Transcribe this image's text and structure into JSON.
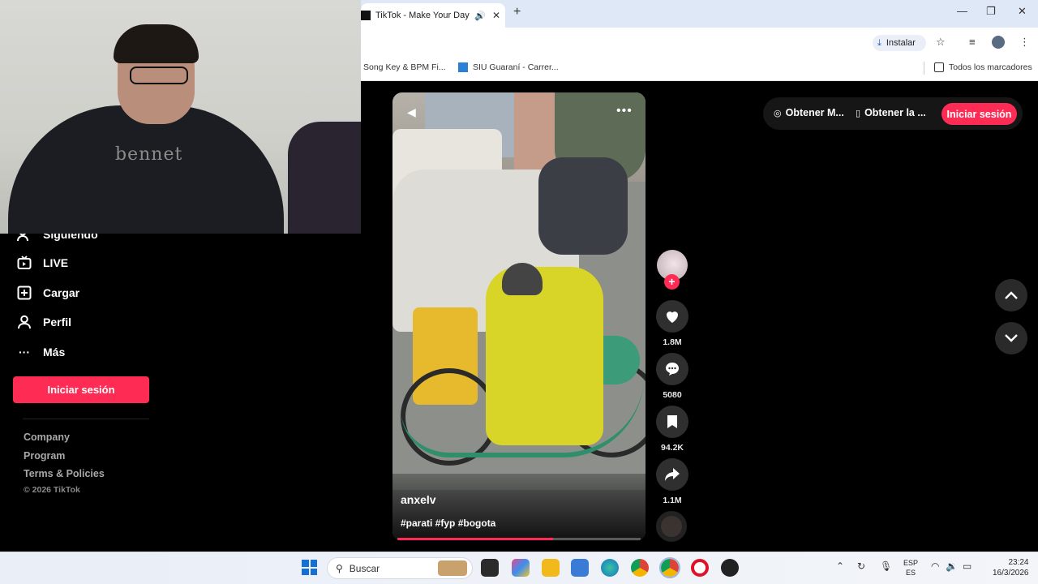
{
  "browser": {
    "tab_title": "TikTok - Make Your Day",
    "tab_audio_icon": "speaker-icon",
    "tab_close": "✕",
    "new_tab": "+",
    "window_controls": [
      "—",
      "❐",
      "✕"
    ],
    "install_label": "Instalar",
    "bookmarks": [
      "Song Key & BPM Fi...",
      "SIU Guaraní - Carrer..."
    ],
    "all_bookmarks": "Todos los marcadores"
  },
  "webcam": {
    "shirt_text": "bennet"
  },
  "sidebar": {
    "items": [
      {
        "label": "Siguiendo",
        "icon": "following-icon"
      },
      {
        "label": "LIVE",
        "icon": "live-icon"
      },
      {
        "label": "Cargar",
        "icon": "upload-icon"
      },
      {
        "label": "Perfil",
        "icon": "profile-icon"
      },
      {
        "label": "Más",
        "icon": "more-icon"
      }
    ],
    "login": "Iniciar sesión",
    "footer_links": [
      "Company",
      "Program",
      "Terms & Policies"
    ],
    "copyright": "© 2026 TikTok"
  },
  "video": {
    "username": "anxelv",
    "hashtags": "#parati #fyp #bogota",
    "more": "•••",
    "progress": 0.64
  },
  "actions": {
    "follow": "+",
    "likes": "1.8M",
    "comments": "5080",
    "saves": "94.2K",
    "shares": "1.1M"
  },
  "topbar": {
    "get_coins": "Obtener M...",
    "get_app": "Obtener la ...",
    "login": "Iniciar sesión"
  },
  "taskbar": {
    "search_placeholder": "Buscar",
    "lang_top": "ESP",
    "lang_bottom": "ES",
    "time": "23:24",
    "date": "16/3/2026"
  },
  "colors": {
    "accent": "#fe2c55",
    "background": "#000000"
  }
}
